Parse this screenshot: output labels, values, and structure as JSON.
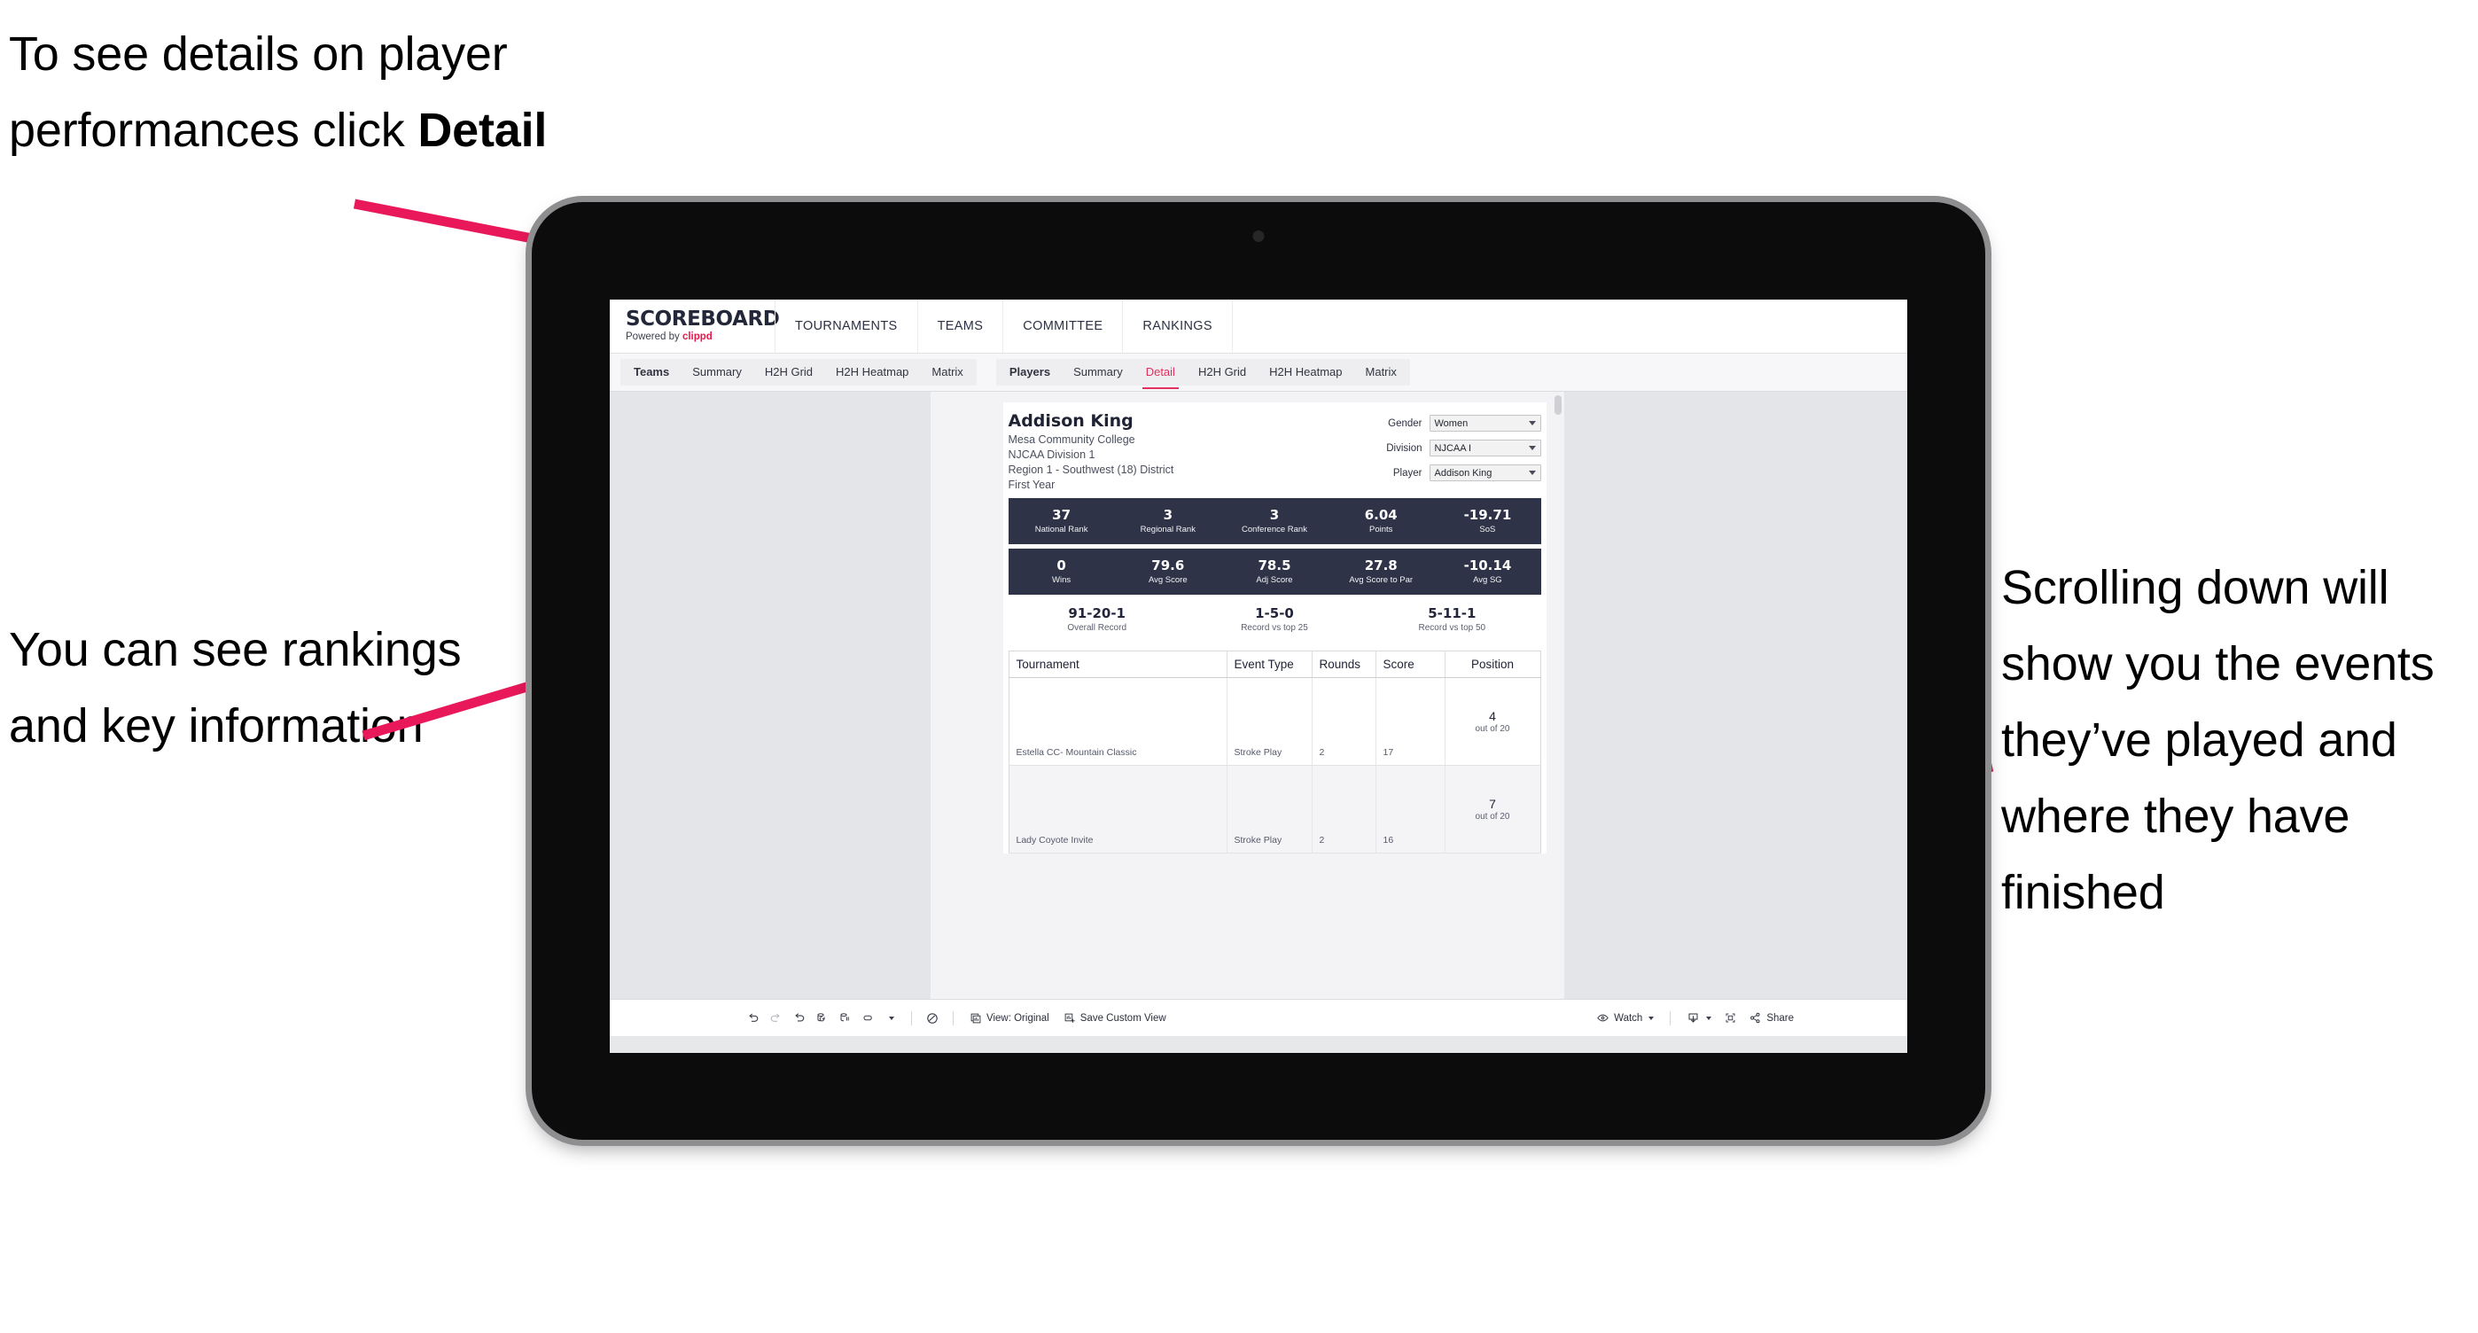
{
  "annotations": {
    "top_left": "To see details on player performances click ",
    "top_left_bold": "Detail",
    "bottom_left": "You can see rankings and key information",
    "right": "Scrolling down will show you the events they’ve played and where they have finished"
  },
  "app": {
    "brand": {
      "title": "SCOREBOARD",
      "powered_prefix": "Powered by ",
      "powered_name": "clippd"
    },
    "topnav": [
      {
        "label": "TOURNAMENTS"
      },
      {
        "label": "TEAMS"
      },
      {
        "label": "COMMITTEE"
      },
      {
        "label": "RANKINGS"
      }
    ],
    "tabs": {
      "teams_group": [
        {
          "label": "Teams",
          "active": false
        },
        {
          "label": "Summary",
          "active": false
        },
        {
          "label": "H2H Grid",
          "active": false
        },
        {
          "label": "H2H Heatmap",
          "active": false
        },
        {
          "label": "Matrix",
          "active": false
        }
      ],
      "players_group": [
        {
          "label": "Players",
          "active": false
        },
        {
          "label": "Summary",
          "active": false
        },
        {
          "label": "Detail",
          "active": true
        },
        {
          "label": "H2H Grid",
          "active": false
        },
        {
          "label": "H2H Heatmap",
          "active": false
        },
        {
          "label": "Matrix",
          "active": false
        }
      ]
    },
    "colors": {
      "accent_pink": "#e0315c",
      "brand_red": "#e8174b",
      "stat_bar_navy": "#2e3347",
      "annotation_arrow": "#e8185a"
    }
  },
  "player": {
    "name": "Addison King",
    "school": "Mesa Community College",
    "division": "NJCAA Division 1",
    "region": "Region 1 - Southwest (18) District",
    "year": "First Year"
  },
  "filters": [
    {
      "label": "Gender",
      "value": "Women"
    },
    {
      "label": "Division",
      "value": "NJCAA I"
    },
    {
      "label": "Player",
      "value": "Addison King"
    }
  ],
  "stats_row1": [
    {
      "value": "37",
      "label": "National Rank"
    },
    {
      "value": "3",
      "label": "Regional Rank"
    },
    {
      "value": "3",
      "label": "Conference Rank"
    },
    {
      "value": "6.04",
      "label": "Points"
    },
    {
      "value": "-19.71",
      "label": "SoS"
    }
  ],
  "stats_row2": [
    {
      "value": "0",
      "label": "Wins"
    },
    {
      "value": "79.6",
      "label": "Avg Score"
    },
    {
      "value": "78.5",
      "label": "Adj Score"
    },
    {
      "value": "27.8",
      "label": "Avg Score to Par"
    },
    {
      "value": "-10.14",
      "label": "Avg SG"
    }
  ],
  "records": [
    {
      "value": "91-20-1",
      "label": "Overall Record"
    },
    {
      "value": "1-5-0",
      "label": "Record vs top 25"
    },
    {
      "value": "5-11-1",
      "label": "Record vs top 50"
    }
  ],
  "table": {
    "headers": [
      "Tournament",
      "Event Type",
      "Rounds",
      "Score",
      "Position"
    ],
    "rows": [
      {
        "tournament": "Estella CC- Mountain Classic",
        "event_type": "Stroke Play",
        "rounds": "2",
        "score": "17",
        "position": "4",
        "position_sub": "out of 20"
      },
      {
        "tournament": "Lady Coyote Invite",
        "event_type": "Stroke Play",
        "rounds": "2",
        "score": "16",
        "position": "7",
        "position_sub": "out of 20"
      }
    ]
  },
  "toolbar": {
    "view_label": "View: Original",
    "save_label": "Save Custom View",
    "watch_label": "Watch",
    "share_label": "Share"
  }
}
